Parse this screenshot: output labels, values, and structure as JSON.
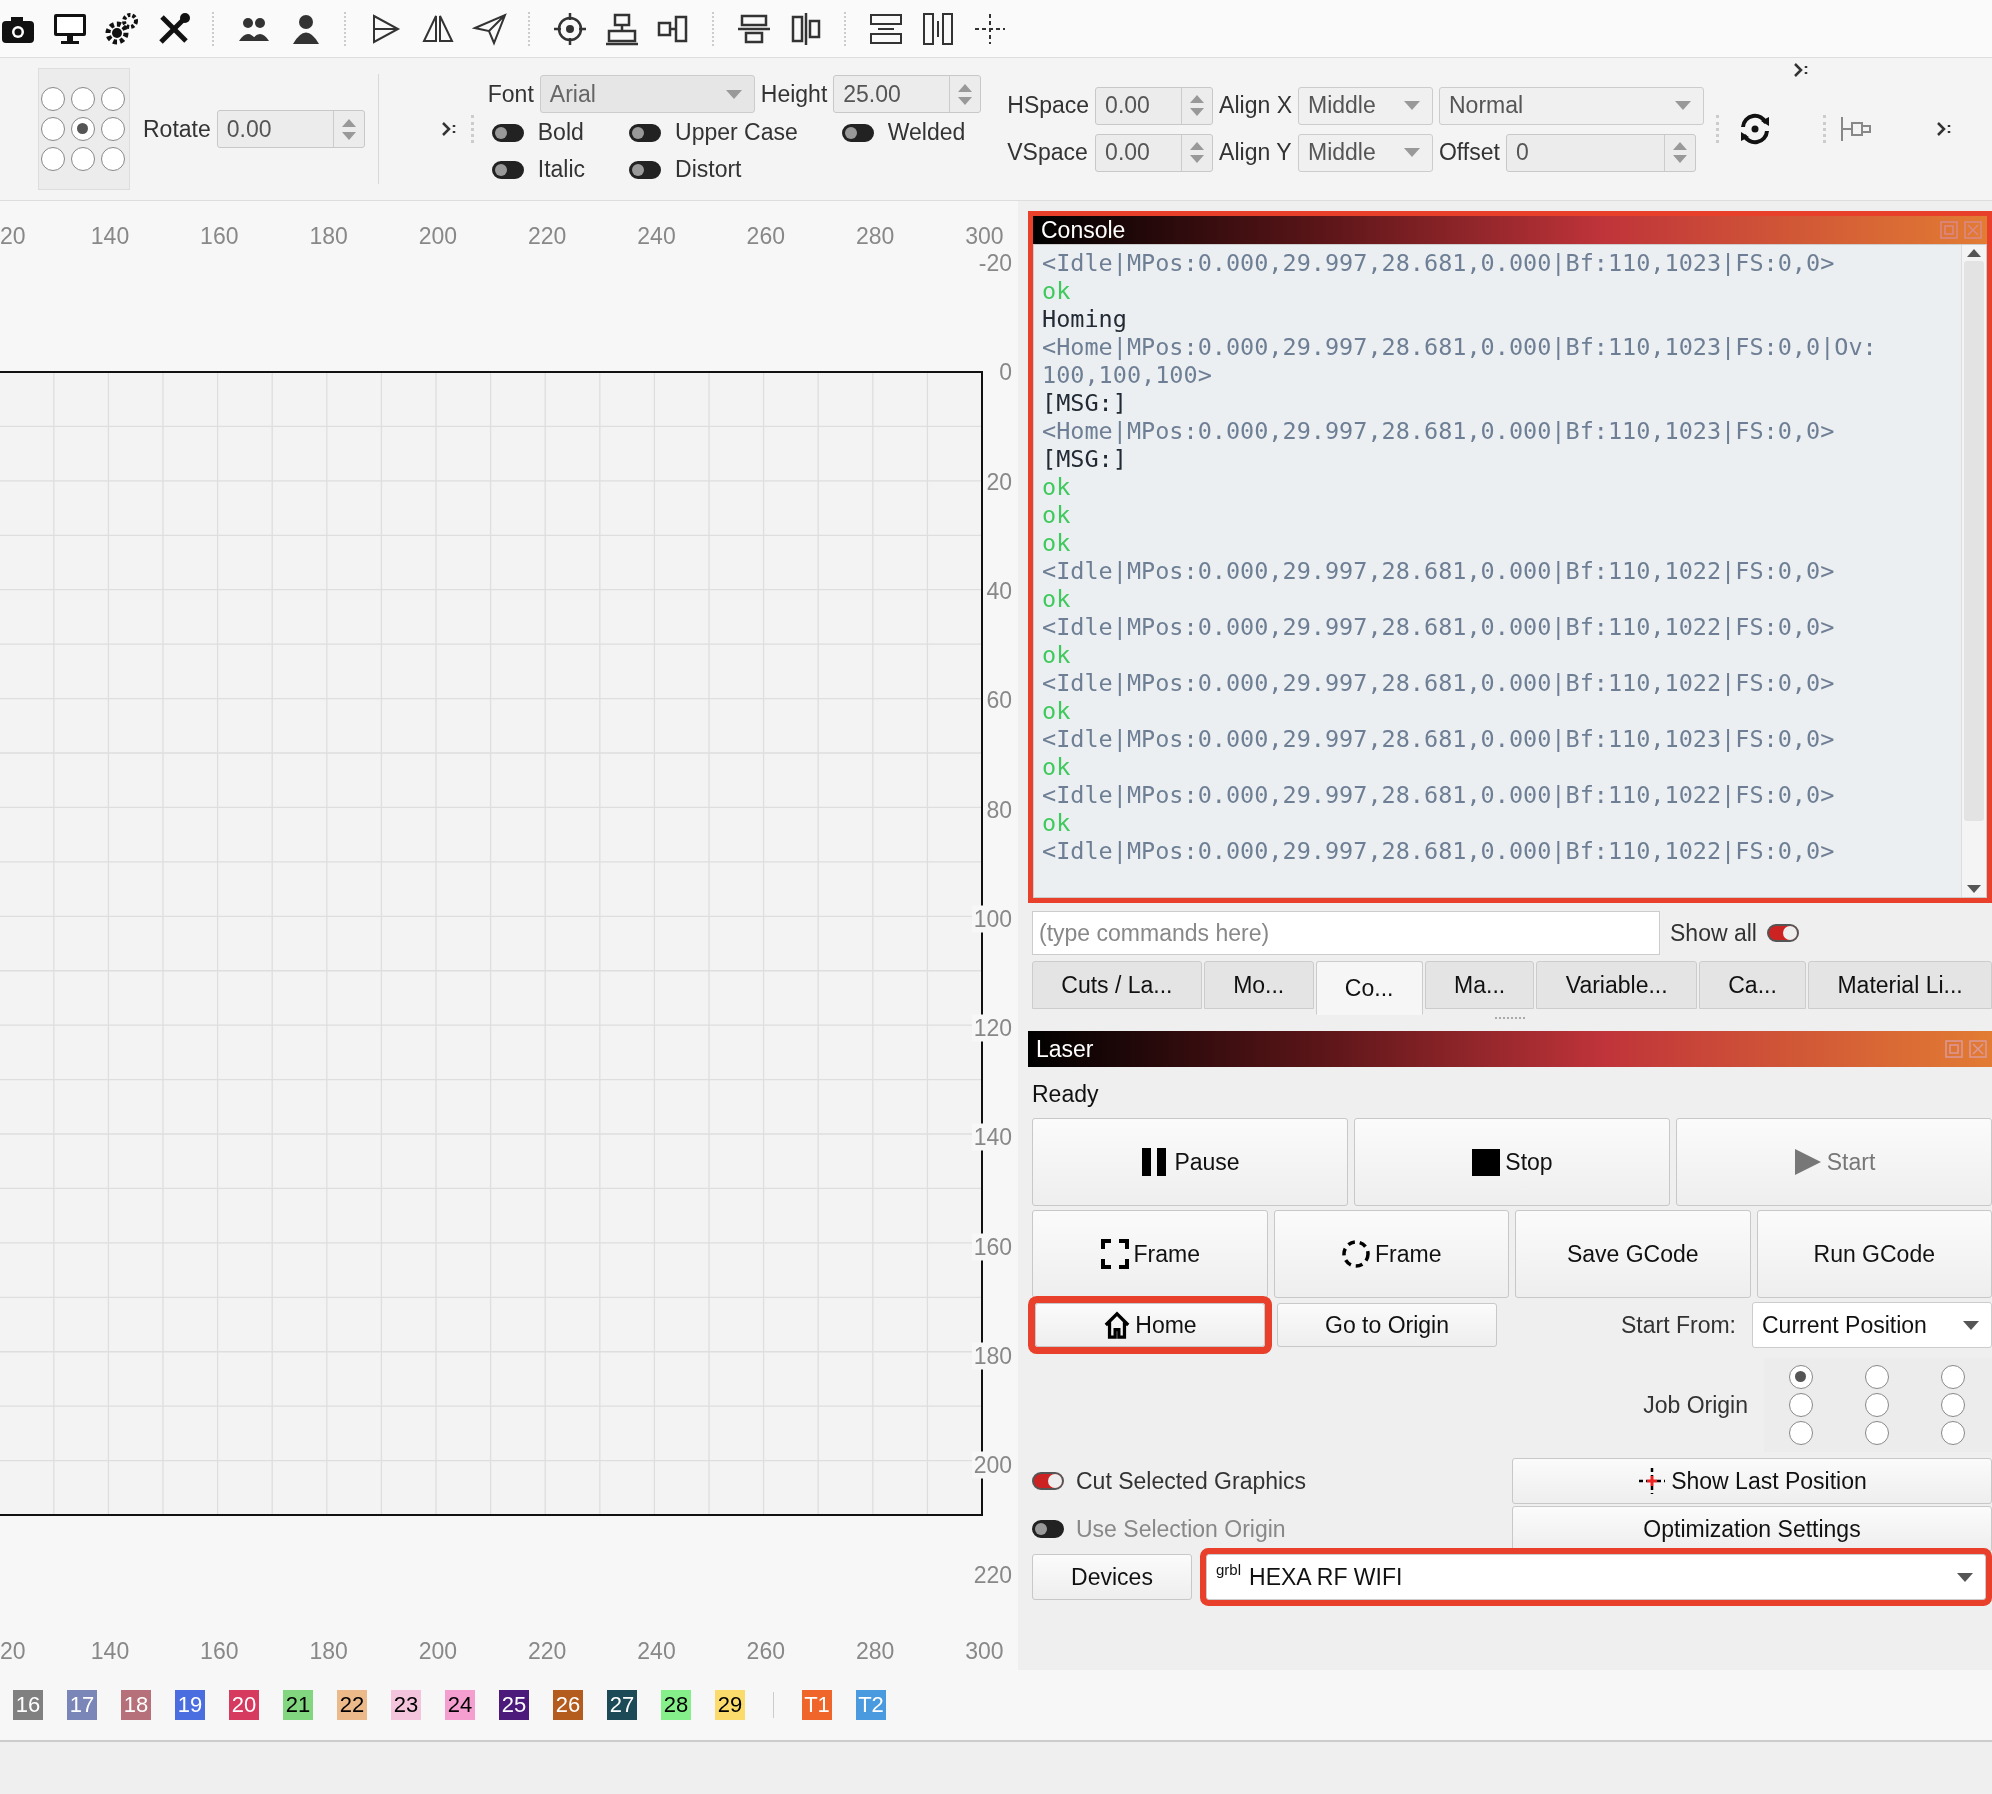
{
  "text_options": {
    "origin_grid": [
      {
        "selected": false
      },
      {
        "selected": false
      },
      {
        "selected": false
      },
      {
        "selected": false
      },
      {
        "selected": true
      },
      {
        "selected": false
      },
      {
        "selected": false
      },
      {
        "selected": false
      },
      {
        "selected": false
      }
    ],
    "rotate": {
      "label": "Rotate",
      "value": "0.00"
    },
    "font": {
      "label": "Font",
      "value": "Arial"
    },
    "height": {
      "label": "Height",
      "value": "25.00"
    },
    "toggles": [
      {
        "label": "Bold",
        "on": false
      },
      {
        "label": "Upper Case",
        "on": false
      },
      {
        "label": "Welded",
        "on": false
      },
      {
        "label": "Italic",
        "on": false
      },
      {
        "label": "Distort",
        "on": false
      }
    ],
    "hspace": {
      "label": "HSpace",
      "value": "0.00"
    },
    "align_x": {
      "label": "Align X",
      "value": "Middle"
    },
    "mode": {
      "value": "Normal"
    },
    "vspace": {
      "label": "VSpace",
      "value": "0.00"
    },
    "align_y": {
      "label": "Align Y",
      "value": "Middle"
    },
    "offset": {
      "label": "Offset",
      "value": "0"
    }
  },
  "canvas": {
    "top_ruler": [
      "20",
      "140",
      "160",
      "180",
      "200",
      "220",
      "240",
      "260",
      "280",
      "300"
    ],
    "side_ruler": [
      "-20",
      "0",
      "20",
      "40",
      "60",
      "80",
      "100",
      "120",
      "140",
      "160",
      "180",
      "200",
      "220"
    ],
    "bottom_ruler": [
      "20",
      "140",
      "160",
      "180",
      "200",
      "220",
      "240",
      "260",
      "280",
      "300"
    ]
  },
  "console": {
    "title": "Console",
    "highlighted": true,
    "lines": [
      {
        "kind": "status",
        "text": "<Idle|MPos:0.000,29.997,28.681,0.000|Bf:110,1023|FS:0,0>"
      },
      {
        "kind": "ok",
        "text": "ok"
      },
      {
        "kind": "message",
        "text": "Homing"
      },
      {
        "kind": "status",
        "text": "<Home|MPos:0.000,29.997,28.681,0.000|Bf:110,1023|FS:0,0|Ov:"
      },
      {
        "kind": "status",
        "text": "100,100,100>"
      },
      {
        "kind": "message",
        "text": "[MSG:]"
      },
      {
        "kind": "status",
        "text": "<Home|MPos:0.000,29.997,28.681,0.000|Bf:110,1023|FS:0,0>"
      },
      {
        "kind": "message",
        "text": "[MSG:]"
      },
      {
        "kind": "ok",
        "text": "ok"
      },
      {
        "kind": "ok",
        "text": "ok"
      },
      {
        "kind": "ok",
        "text": "ok"
      },
      {
        "kind": "status",
        "text": "<Idle|MPos:0.000,29.997,28.681,0.000|Bf:110,1022|FS:0,0>"
      },
      {
        "kind": "ok",
        "text": "ok"
      },
      {
        "kind": "status",
        "text": "<Idle|MPos:0.000,29.997,28.681,0.000|Bf:110,1022|FS:0,0>"
      },
      {
        "kind": "ok",
        "text": "ok"
      },
      {
        "kind": "status",
        "text": "<Idle|MPos:0.000,29.997,28.681,0.000|Bf:110,1022|FS:0,0>"
      },
      {
        "kind": "ok",
        "text": "ok"
      },
      {
        "kind": "status",
        "text": "<Idle|MPos:0.000,29.997,28.681,0.000|Bf:110,1023|FS:0,0>"
      },
      {
        "kind": "ok",
        "text": "ok"
      },
      {
        "kind": "status",
        "text": "<Idle|MPos:0.000,29.997,28.681,0.000|Bf:110,1022|FS:0,0>"
      },
      {
        "kind": "ok",
        "text": "ok"
      },
      {
        "kind": "status",
        "text": "<Idle|MPos:0.000,29.997,28.681,0.000|Bf:110,1022|FS:0,0>"
      }
    ],
    "command": {
      "placeholder": "(type commands here)"
    },
    "show_all": {
      "label": "Show all",
      "on": true
    }
  },
  "tabs": [
    {
      "label": "Cuts / La...",
      "selected": false
    },
    {
      "label": "Mo...",
      "selected": false
    },
    {
      "label": "Co...",
      "selected": true
    },
    {
      "label": "Ma...",
      "selected": false
    },
    {
      "label": "Variable...",
      "selected": false
    },
    {
      "label": "Ca...",
      "selected": false
    },
    {
      "label": "Material Li...",
      "selected": false
    }
  ],
  "laser": {
    "title": "Laser",
    "status": "Ready",
    "run_buttons": [
      {
        "label": "Pause",
        "disabled": false
      },
      {
        "label": "Stop",
        "disabled": false
      },
      {
        "label": "Start",
        "disabled": true
      }
    ],
    "action_buttons": [
      {
        "label": "Frame"
      },
      {
        "label": "Frame"
      },
      {
        "label": "Save GCode"
      },
      {
        "label": "Run GCode"
      }
    ],
    "home": {
      "label": "Home",
      "highlighted": true
    },
    "go_to_origin": {
      "label": "Go to Origin"
    },
    "start_from": {
      "label": "Start From:",
      "value": "Current Position"
    },
    "job_origin": {
      "label": "Job Origin",
      "options": [
        {
          "selected": true
        },
        {
          "selected": false
        },
        {
          "selected": false
        },
        {
          "selected": false
        },
        {
          "selected": false
        },
        {
          "selected": false
        },
        {
          "selected": false
        },
        {
          "selected": false
        },
        {
          "selected": false
        }
      ]
    },
    "cut_selected": {
      "label": "Cut Selected Graphics",
      "on": true,
      "disabled": false
    },
    "use_selection_origin": {
      "label": "Use Selection Origin",
      "on": false,
      "disabled": true
    },
    "show_last_position": {
      "label": "Show Last Position"
    },
    "optimization": {
      "label": "Optimization Settings"
    },
    "devices": {
      "label": "Devices"
    },
    "device": {
      "logo": "grbl",
      "value": "HEXA RF WIFI",
      "highlighted": true
    }
  },
  "palette": [
    {
      "label": "16",
      "color": "#808080"
    },
    {
      "label": "17",
      "color": "#7b86b8"
    },
    {
      "label": "18",
      "color": "#b5707a"
    },
    {
      "label": "19",
      "color": "#4a6ee0"
    },
    {
      "label": "20",
      "color": "#d63a5f"
    },
    {
      "label": "21",
      "color": "#82d67f"
    },
    {
      "label": "22",
      "color": "#ecb98a"
    },
    {
      "label": "23",
      "color": "#f4c4dc"
    },
    {
      "label": "24",
      "color": "#f59ed0"
    },
    {
      "label": "25",
      "color": "#4b1a7a"
    },
    {
      "label": "26",
      "color": "#b35c1e"
    },
    {
      "label": "27",
      "color": "#1d4a57"
    },
    {
      "label": "28",
      "color": "#85f08a"
    },
    {
      "label": "29",
      "color": "#fadb6c"
    },
    {
      "label": "T1",
      "color": "#f0652a"
    },
    {
      "label": "T2",
      "color": "#4a9ae0"
    }
  ]
}
